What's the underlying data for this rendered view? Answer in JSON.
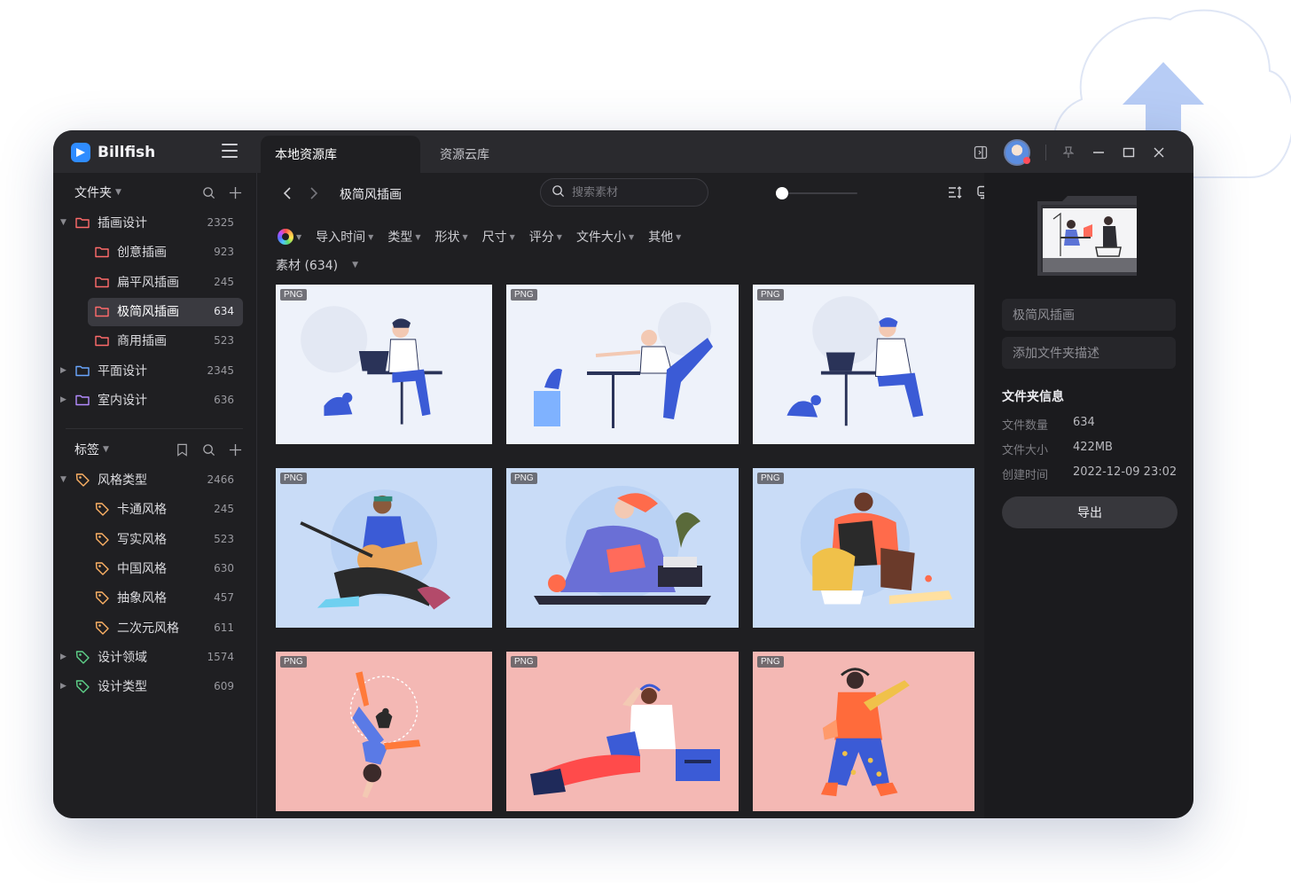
{
  "app": {
    "name": "Billfish"
  },
  "tabs": [
    {
      "label": "本地资源库",
      "active": true
    },
    {
      "label": "资源云库",
      "active": false
    }
  ],
  "sidebar": {
    "folders_header": "文件夹",
    "folders": [
      {
        "label": "插画设计",
        "count": "2325",
        "level": 0,
        "expanded": true
      },
      {
        "label": "创意插画",
        "count": "923",
        "level": 1
      },
      {
        "label": "扁平风插画",
        "count": "245",
        "level": 1
      },
      {
        "label": "极简风插画",
        "count": "634",
        "level": 1,
        "selected": true
      },
      {
        "label": "商用插画",
        "count": "523",
        "level": 1
      },
      {
        "label": "平面设计",
        "count": "2345",
        "level": 0,
        "expanded": false
      },
      {
        "label": "室内设计",
        "count": "636",
        "level": 0,
        "expanded": false
      }
    ],
    "tags_header": "标签",
    "tags": [
      {
        "label": "风格类型",
        "count": "2466",
        "level": 0,
        "expanded": true
      },
      {
        "label": "卡通风格",
        "count": "245",
        "level": 1
      },
      {
        "label": "写实风格",
        "count": "523",
        "level": 1
      },
      {
        "label": "中国风格",
        "count": "630",
        "level": 1
      },
      {
        "label": "抽象风格",
        "count": "457",
        "level": 1
      },
      {
        "label": "二次元风格",
        "count": "611",
        "level": 1
      },
      {
        "label": "设计领域",
        "count": "1574",
        "level": 0,
        "expanded": false
      },
      {
        "label": "设计类型",
        "count": "609",
        "level": 0,
        "expanded": false
      }
    ]
  },
  "toolbar": {
    "breadcrumb": "极简风插画",
    "search_placeholder": "搜索素材",
    "thumb_size_level": 0.0
  },
  "filters": [
    "导入时间",
    "类型",
    "形状",
    "尺寸",
    "评分",
    "文件大小",
    "其他"
  ],
  "material_count": "素材 (634)",
  "grid": [
    {
      "badge": "PNG",
      "bg": "#eef2fa",
      "scene": "laptop-dog"
    },
    {
      "badge": "PNG",
      "bg": "#eef2fa",
      "scene": "yoga-dog"
    },
    {
      "badge": "PNG",
      "bg": "#eef2fa",
      "scene": "laptop-cat"
    },
    {
      "badge": "PNG",
      "bg": "#c9dcf7",
      "scene": "guitar"
    },
    {
      "badge": "PNG",
      "bg": "#c9dcf7",
      "scene": "reading"
    },
    {
      "badge": "PNG",
      "bg": "#c9dcf7",
      "scene": "pizza"
    },
    {
      "badge": "PNG",
      "bg": "#f4b8b4",
      "scene": "handstand"
    },
    {
      "badge": "PNG",
      "bg": "#f4b8b4",
      "scene": "music"
    },
    {
      "badge": "PNG",
      "bg": "#f4b8b4",
      "scene": "walking"
    }
  ],
  "right_panel": {
    "folder_name": "极简风插画",
    "description_placeholder": "添加文件夹描述",
    "info_title": "文件夹信息",
    "info": [
      {
        "key": "文件数量",
        "value": "634"
      },
      {
        "key": "文件大小",
        "value": "422MB"
      },
      {
        "key": "创建时间",
        "value": "2022-12-09 23:02"
      }
    ],
    "export_label": "导出"
  },
  "colors": {
    "accent": "#2f8cff",
    "folder_icon": "#ff6b6b",
    "folder_icon_alt": "#6aa7ff",
    "folder_icon_purple": "#b48cff",
    "tag_icon": "#ffb366",
    "tag_icon_green": "#5fd38a"
  }
}
